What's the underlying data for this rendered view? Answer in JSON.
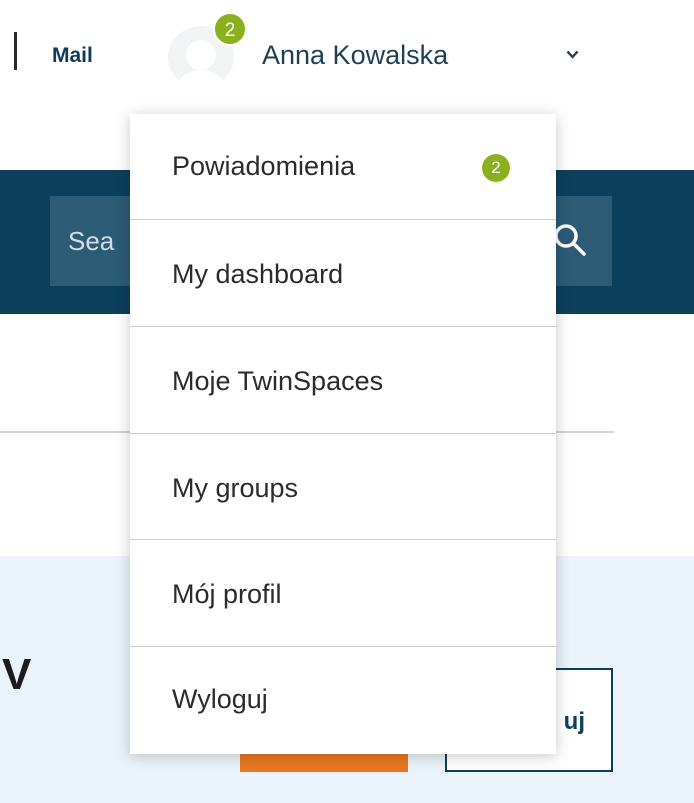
{
  "header": {
    "mail_label": "Mail",
    "user_name": "Anna Kowalska",
    "notification_count": "2"
  },
  "search": {
    "placeholder_visible": "Sea"
  },
  "background": {
    "headline_fragment": "V",
    "outline_button_fragment": "uj"
  },
  "dropdown": {
    "items": [
      {
        "label": "Powiadomienia",
        "badge": "2"
      },
      {
        "label": "My dashboard"
      },
      {
        "label": "Moje TwinSpaces"
      },
      {
        "label": "My groups"
      },
      {
        "label": "Mój profil"
      },
      {
        "label": "Wyloguj"
      }
    ]
  },
  "colors": {
    "brand_navy": "#0b3f5c",
    "badge_green": "#8bb01e",
    "accent_orange": "#e87722",
    "light_band": "#eaf3f9"
  },
  "icons": {
    "search": "search-icon",
    "chevron": "chevron-down-icon",
    "avatar": "user-avatar-icon"
  }
}
